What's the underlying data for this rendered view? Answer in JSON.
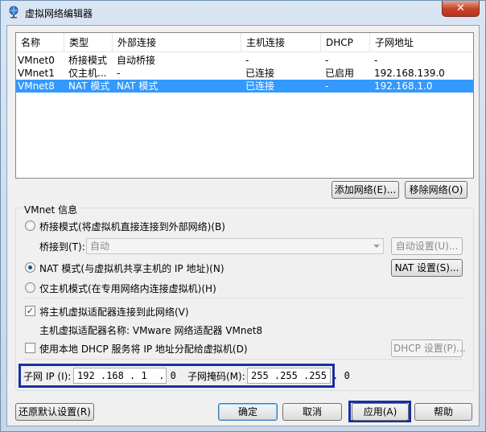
{
  "window": {
    "title": "虚拟网络编辑器",
    "close_glyph": "✕"
  },
  "network_list": {
    "columns": [
      "名称",
      "类型",
      "外部连接",
      "主机连接",
      "DHCP",
      "子网地址"
    ],
    "rows": [
      {
        "name": "VMnet0",
        "type": "桥接模式",
        "external": "自动桥接",
        "host": "-",
        "dhcp": "-",
        "subnet": "-"
      },
      {
        "name": "VMnet1",
        "type": "仅主机...",
        "external": "-",
        "host": "已连接",
        "dhcp": "已启用",
        "subnet": "192.168.139.0"
      },
      {
        "name": "VMnet8",
        "type": "NAT 模式",
        "external": "NAT 模式",
        "host": "已连接",
        "dhcp": "-",
        "subnet": "192.168.1.0"
      }
    ],
    "selected_index": 2
  },
  "buttons": {
    "add_network": "添加网络(E)...",
    "remove_network": "移除网络(O)",
    "auto_settings": "自动设置(U)...",
    "nat_settings": "NAT 设置(S)...",
    "dhcp_settings": "DHCP 设置(P)...",
    "restore_defaults": "还原默认设置(R)",
    "ok": "确定",
    "cancel": "取消",
    "apply": "应用(A)",
    "help": "帮助"
  },
  "vmnet_info": {
    "group_label": "VMnet 信息",
    "bridged_label": "桥接模式(将虚拟机直接连接到外部网络)(B)",
    "bridged_to_label": "桥接到(T):",
    "bridged_to_value": "自动",
    "nat_label": "NAT 模式(与虚拟机共享主机的 IP 地址)(N)",
    "host_only_label": "仅主机模式(在专用网络内连接虚拟机)(H)",
    "selected_mode": "nat",
    "connect_adapter_label": "将主机虚拟适配器连接到此网络(V)",
    "connect_adapter_checked": true,
    "adapter_name_label": "主机虚拟适配器名称: VMware 网络适配器 VMnet8",
    "dhcp_label": "使用本地 DHCP 服务将 IP 地址分配给虚拟机(D)",
    "dhcp_checked": false,
    "subnet_ip_label": "子网 IP (I):",
    "subnet_ip_value": "192 .168 . 1  . 0",
    "subnet_mask_label": "子网掩码(M):",
    "subnet_mask_value": "255 .255 .255 . 0"
  },
  "colors": {
    "selection": "#3399ff",
    "highlight_frame": "#1a2fa0"
  }
}
